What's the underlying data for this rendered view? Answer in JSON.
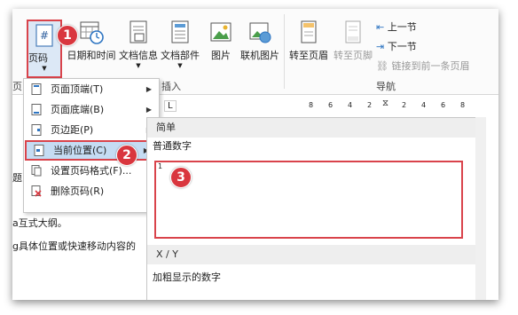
{
  "ribbon": {
    "page_number": "页码",
    "date_time": "日期和时间",
    "doc_info": "文档信息",
    "doc_parts": "文档部件",
    "picture": "图片",
    "online_picture": "联机图片",
    "goto_header": "转至页眉",
    "goto_footer": "转至页脚",
    "prev_section": "上一节",
    "next_section": "下一节",
    "link_previous": "链接到前一条页眉",
    "insert_group": "插入",
    "nav_group": "导航",
    "tab_fragment": "页"
  },
  "menu": {
    "items": [
      {
        "label": "页面顶端(T)",
        "arrow": "▶"
      },
      {
        "label": "页面底端(B)",
        "arrow": "▶"
      },
      {
        "label": "页边距(P)",
        "arrow": "▶"
      },
      {
        "label": "当前位置(C)",
        "arrow": "▶"
      },
      {
        "label": "设置页码格式(F)...",
        "arrow": ""
      },
      {
        "label": "删除页码(R)",
        "arrow": ""
      }
    ]
  },
  "submenu": {
    "ruler_marker": "L",
    "ruler_numbers": [
      "8",
      "6",
      "4",
      "2",
      "2",
      "4",
      "6",
      "8"
    ],
    "section1": "简单",
    "item1": "普通数字",
    "preview_number": "1",
    "section2": "X / Y",
    "item2": "加粗显示的数字"
  },
  "document": {
    "line1": "a互式大纲。",
    "line2": "g具体位置或快速移动内容的"
  },
  "badges": [
    "1",
    "2",
    "3"
  ],
  "colors": {
    "highlight_border": "#d9434b",
    "menu_highlight": "#c5dcf3",
    "badge": "#d9363e"
  }
}
